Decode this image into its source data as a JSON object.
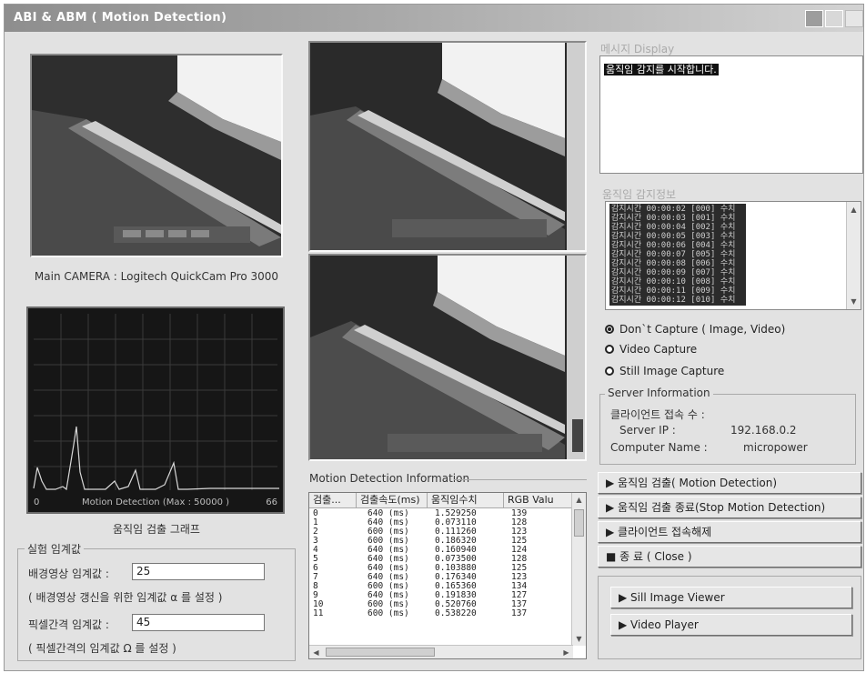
{
  "window": {
    "title": "ABI & ABM ( Motion Detection)"
  },
  "camera": {
    "caption": "Main CAMERA : Logitech QuickCam Pro 3000"
  },
  "graph": {
    "axis_min": "0",
    "axis_label": "Motion Detection (Max : 50000 )",
    "axis_max": "66",
    "caption": "움직임 검출 그래프"
  },
  "threshold": {
    "group_title": "실험 임계값",
    "bg_label": "배경영상 임계값  :",
    "bg_value": "25",
    "bg_hint": "( 배경영상 갱신을 위한 임계값  α 를 설정 )",
    "pixel_label": "픽셀간격 임계값  :",
    "pixel_value": "45",
    "pixel_hint": "( 픽셀간격의 임계값  Ω 를 설정 )"
  },
  "motion_info": {
    "title": "Motion Detection Information",
    "columns": [
      "검출...",
      "검출속도(ms)",
      "움직임수치",
      "RGB Valu"
    ],
    "rows": [
      [
        "0",
        "640 (ms)",
        "1.529250",
        "139"
      ],
      [
        "1",
        "640 (ms)",
        "0.073110",
        "128"
      ],
      [
        "2",
        "600 (ms)",
        "0.111260",
        "123"
      ],
      [
        "3",
        "600 (ms)",
        "0.186320",
        "125"
      ],
      [
        "4",
        "640 (ms)",
        "0.160940",
        "124"
      ],
      [
        "5",
        "640 (ms)",
        "0.073500",
        "128"
      ],
      [
        "6",
        "640 (ms)",
        "0.103880",
        "125"
      ],
      [
        "7",
        "640 (ms)",
        "0.176340",
        "123"
      ],
      [
        "8",
        "600 (ms)",
        "0.165360",
        "134"
      ],
      [
        "9",
        "640 (ms)",
        "0.191830",
        "127"
      ],
      [
        "10",
        "600 (ms)",
        "0.520760",
        "137"
      ],
      [
        "11",
        "600 (ms)",
        "0.538220",
        "137"
      ]
    ]
  },
  "message": {
    "title": "메시지 Display",
    "text": "움직임 감지를 시작합니다."
  },
  "detect": {
    "title": "움직임 감지정보",
    "lines": [
      "감지시간 00:00:02 [000] 수치",
      "감지시간 00:00:03 [001] 수치",
      "감지시간 00:00:04 [002] 수치",
      "감지시간 00:00:05 [003] 수치",
      "감지시간 00:00:06 [004] 수치",
      "감지시간 00:00:07 [005] 수치",
      "감지시간 00:00:08 [006] 수치",
      "감지시간 00:00:09 [007] 수치",
      "감지시간 00:00:10 [008] 수치",
      "감지시간 00:00:11 [009] 수치",
      "감지시간 00:00:12 [010] 수치"
    ]
  },
  "capture": {
    "options": [
      {
        "label": "Don`t Capture ( Image, Video)",
        "selected": true
      },
      {
        "label": "Video Capture",
        "selected": false
      },
      {
        "label": "Still Image Capture",
        "selected": false
      }
    ]
  },
  "server": {
    "group_title": "Server Information",
    "client_count_label": "클라이언트 접속 수 :",
    "ip_label": "Server IP :",
    "ip_value": "192.168.0.2",
    "name_label": "Computer Name :",
    "name_value": "micropower"
  },
  "actions": {
    "start_detection": "▶ 움직임 검출( Motion Detection)",
    "stop_detection": "▶ 움직임 검출 종료(Stop Motion Detection)",
    "disconnect": "▶ 클라이언트 접속해제",
    "close": "■ 종  료 ( Close )",
    "still_viewer": "▶ Sill Image Viewer",
    "video_player": "▶ Video Player"
  },
  "colors": {
    "window_bg": "#e2e2e2",
    "graph_bg": "#161616",
    "graph_line": "#d8d8d8",
    "grid": "#3a3a3a"
  },
  "icons": [
    "minimize-icon",
    "maximize-icon",
    "close-icon",
    "scroll-up-icon",
    "scroll-down-icon",
    "scroll-left-icon",
    "scroll-right-icon"
  ]
}
